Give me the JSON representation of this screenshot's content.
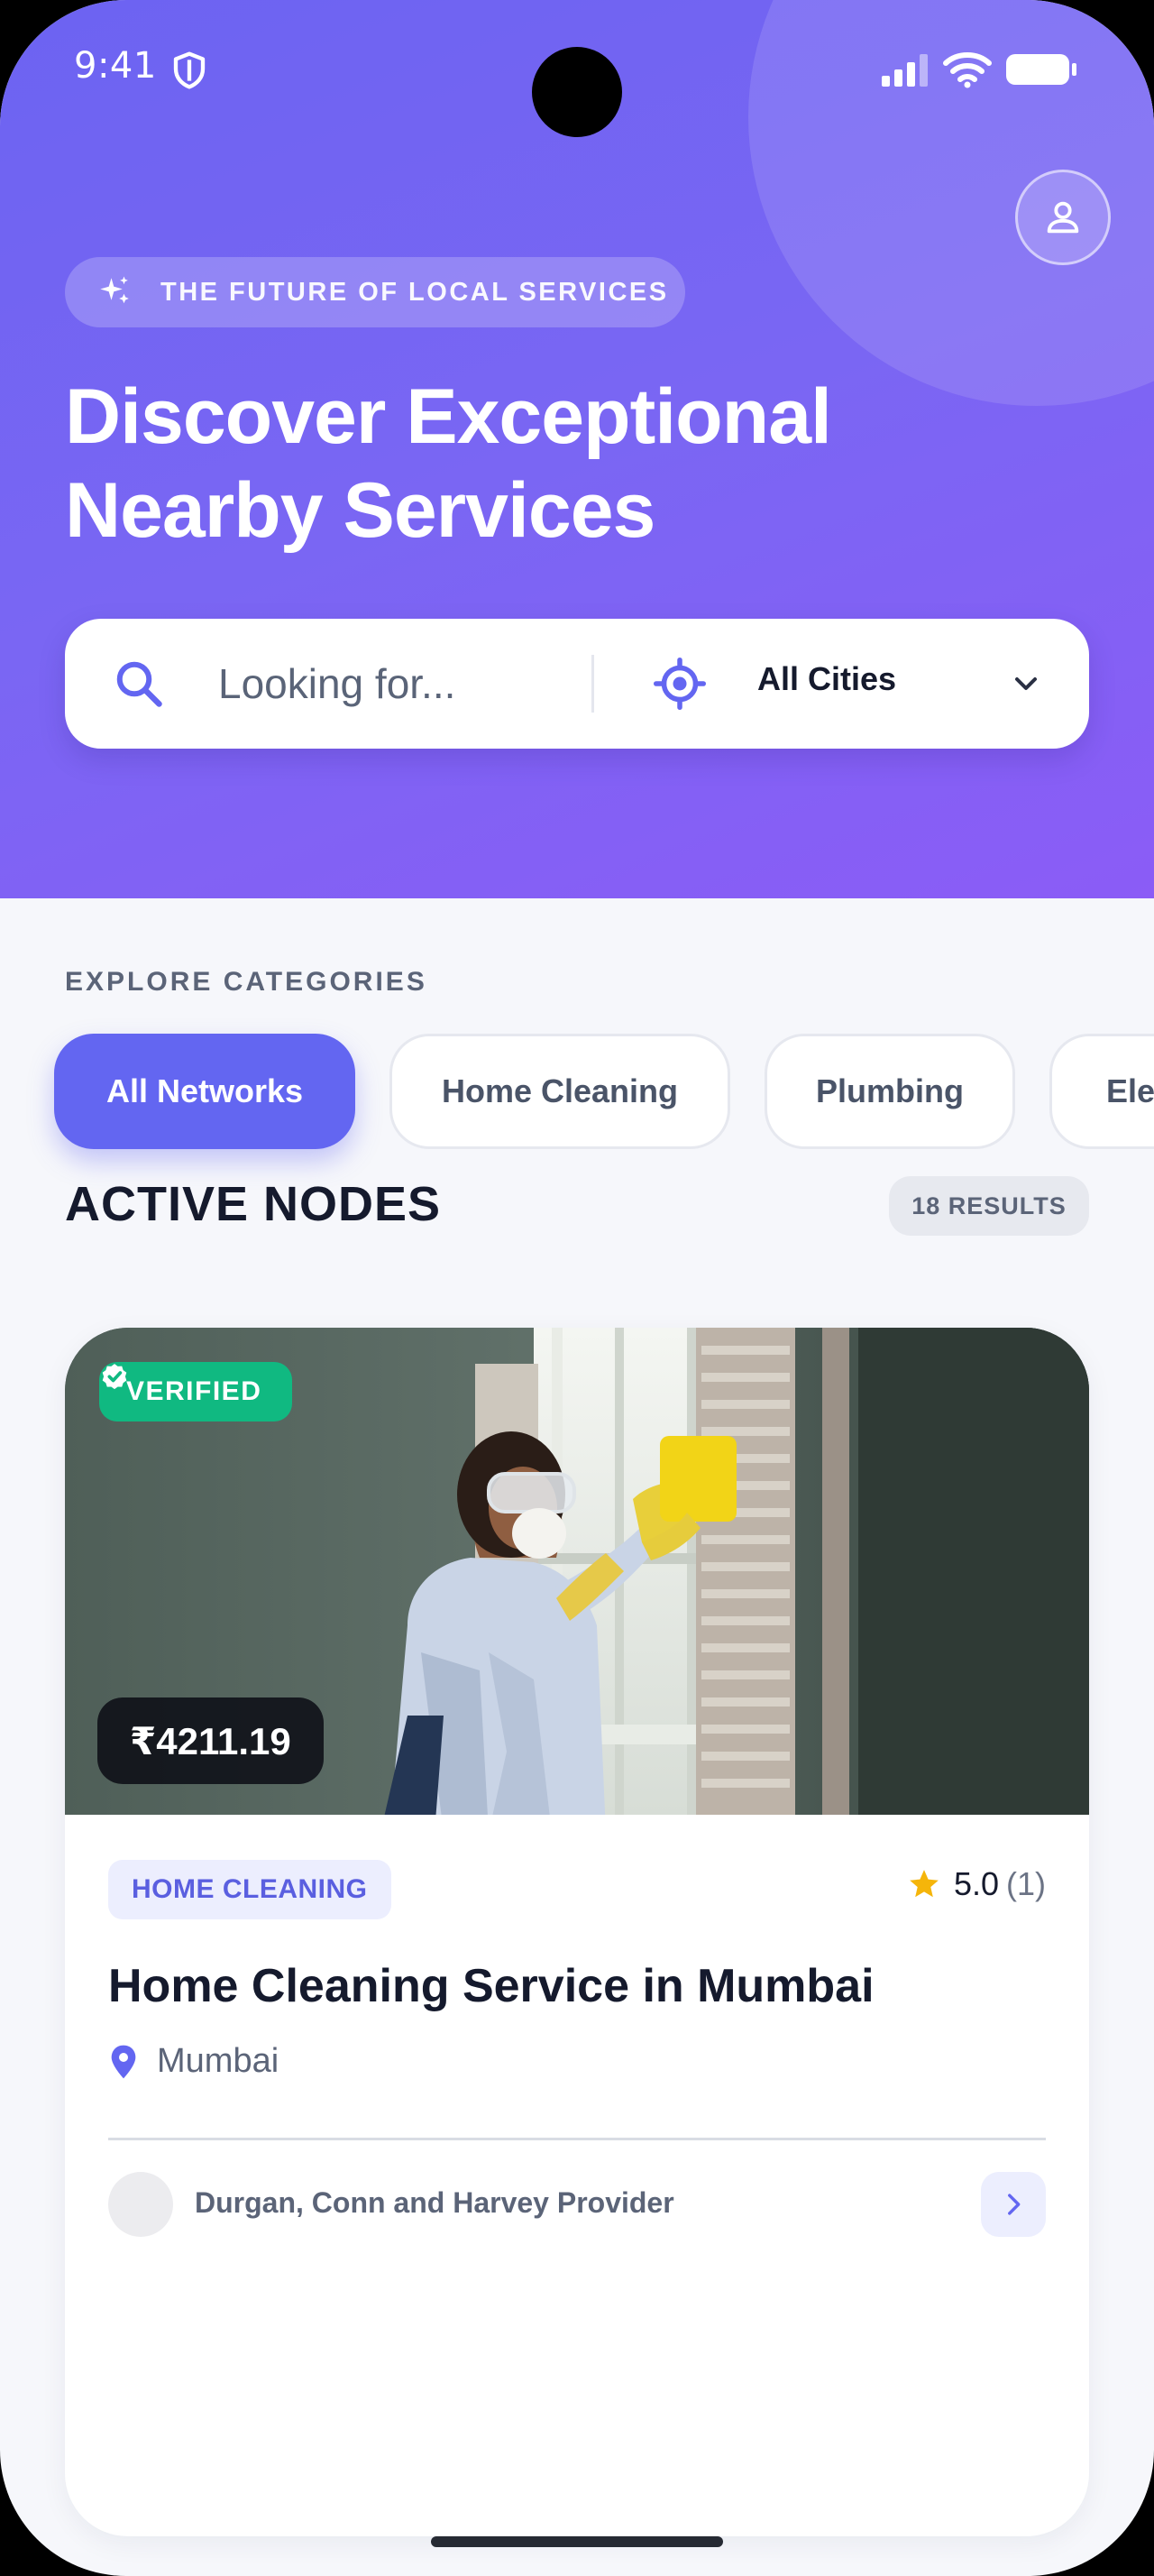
{
  "status_bar": {
    "time": "9:41",
    "icons": [
      "shield-icon",
      "signal-icon",
      "wifi-icon",
      "battery-icon"
    ]
  },
  "hero": {
    "tag": "THE FUTURE OF LOCAL SERVICES",
    "title_line1": "Discover Exceptional",
    "title_line2": "Nearby Services",
    "colors": {
      "start": "#6c63f2",
      "end": "#8b5cf6"
    }
  },
  "search": {
    "placeholder": "Looking for...",
    "city": "All Cities"
  },
  "categories": {
    "label": "EXPLORE CATEGORIES",
    "items": [
      {
        "label": "All Networks",
        "active": true
      },
      {
        "label": "Home Cleaning",
        "active": false
      },
      {
        "label": "Plumbing",
        "active": false
      },
      {
        "label": "Electrical",
        "active": false
      }
    ]
  },
  "results": {
    "title": "ACTIVE NODES",
    "count": "18 RESULTS"
  },
  "listing": {
    "verified": "VERIFIED",
    "price": "₹4211.19",
    "category": "HOME CLEANING",
    "rating": "5.0",
    "rating_count": "(1)",
    "title": "Home Cleaning Service in Mumbai",
    "city": "Mumbai",
    "provider": "Durgan, Conn and Harvey Provider"
  },
  "theme": {
    "accent": "#6366f1",
    "success": "#10b981",
    "star": "#f5b50a"
  }
}
